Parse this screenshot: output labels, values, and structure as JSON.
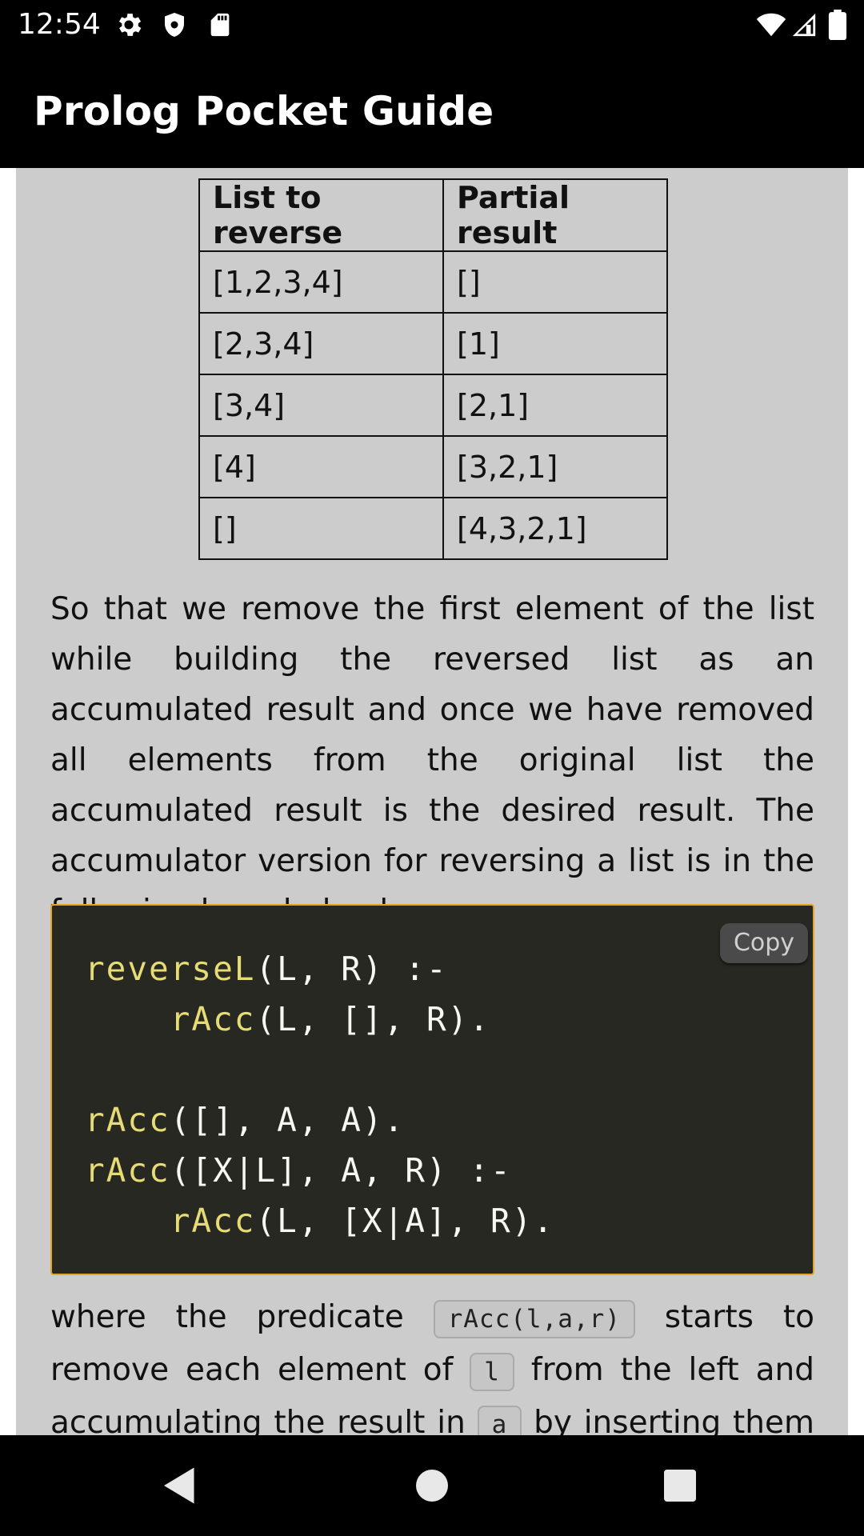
{
  "status_bar": {
    "time": "12:54",
    "left_icons": [
      "settings-icon",
      "shield-icon",
      "sd-card-icon"
    ],
    "right_icons": [
      "wifi-icon",
      "signal-icon",
      "battery-icon"
    ]
  },
  "app_bar": {
    "title": "Prolog Pocket Guide"
  },
  "table": {
    "headers": [
      "List to reverse",
      "Partial result"
    ],
    "rows": [
      [
        "[1,2,3,4]",
        "[]"
      ],
      [
        "[2,3,4]",
        "[1]"
      ],
      [
        "[3,4]",
        "[2,1]"
      ],
      [
        "[4]",
        "[3,2,1]"
      ],
      [
        "[]",
        "[4,3,2,1]"
      ]
    ]
  },
  "paragraph1": "So that we remove the first element of the list while building the reversed list as an accumulated result and once we have removed all elements from the original list the accumulated result is the desired result. The accumulator version for reversing a list is in the following knowledge base",
  "code_block": {
    "copy_label": "Copy",
    "lines": [
      {
        "fn": "reverseL",
        "rest": "(L, R) :-"
      },
      {
        "indent": "    ",
        "fn": "rAcc",
        "rest": "(L, [], R)."
      },
      {
        "fn": "",
        "rest": ""
      },
      {
        "fn": "rAcc",
        "rest": "([], A, A)."
      },
      {
        "fn": "rAcc",
        "rest": "([X|L], A, R) :-"
      },
      {
        "indent": "    ",
        "fn": "rAcc",
        "rest": "(L, [X|A], R)."
      }
    ]
  },
  "paragraph2": {
    "t1": "where the predicate",
    "code1": "rAcc(l,a,r)",
    "t2": "starts to remove each element of",
    "code2": "l",
    "t3": "from the left and accumulating the result in",
    "code3": "a",
    "t4": "by inserting them"
  },
  "nav_bar": {
    "buttons": [
      "back-icon",
      "home-icon",
      "recents-icon"
    ]
  }
}
